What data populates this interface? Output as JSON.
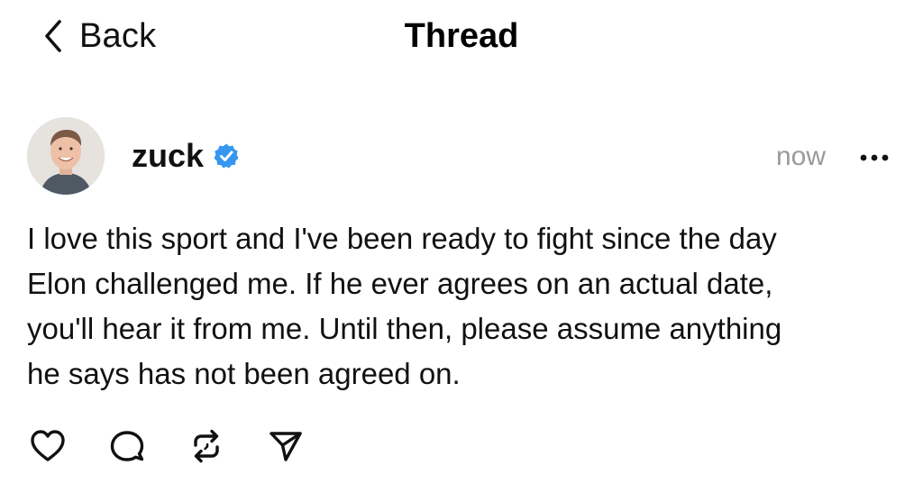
{
  "header": {
    "back_label": "Back",
    "title": "Thread"
  },
  "post": {
    "author": "zuck",
    "verified": true,
    "timestamp": "now",
    "lines": [
      "I love this sport and I've been ready to fight since the day",
      "Elon challenged me. If he ever agrees on an actual date,",
      "you'll hear it from me. Until then, please assume anything",
      "he says has not been agreed on."
    ]
  },
  "icons": {
    "back": "chevron-left-icon",
    "verified": "verified-badge-icon",
    "more": "more-horizontal-icon",
    "like": "heart-icon",
    "reply": "comment-icon",
    "repost": "repost-icon",
    "share": "send-icon"
  },
  "colors": {
    "verified_badge": "#3797f0",
    "muted_text": "#9a9a9a",
    "text": "#111111",
    "background": "#ffffff"
  }
}
